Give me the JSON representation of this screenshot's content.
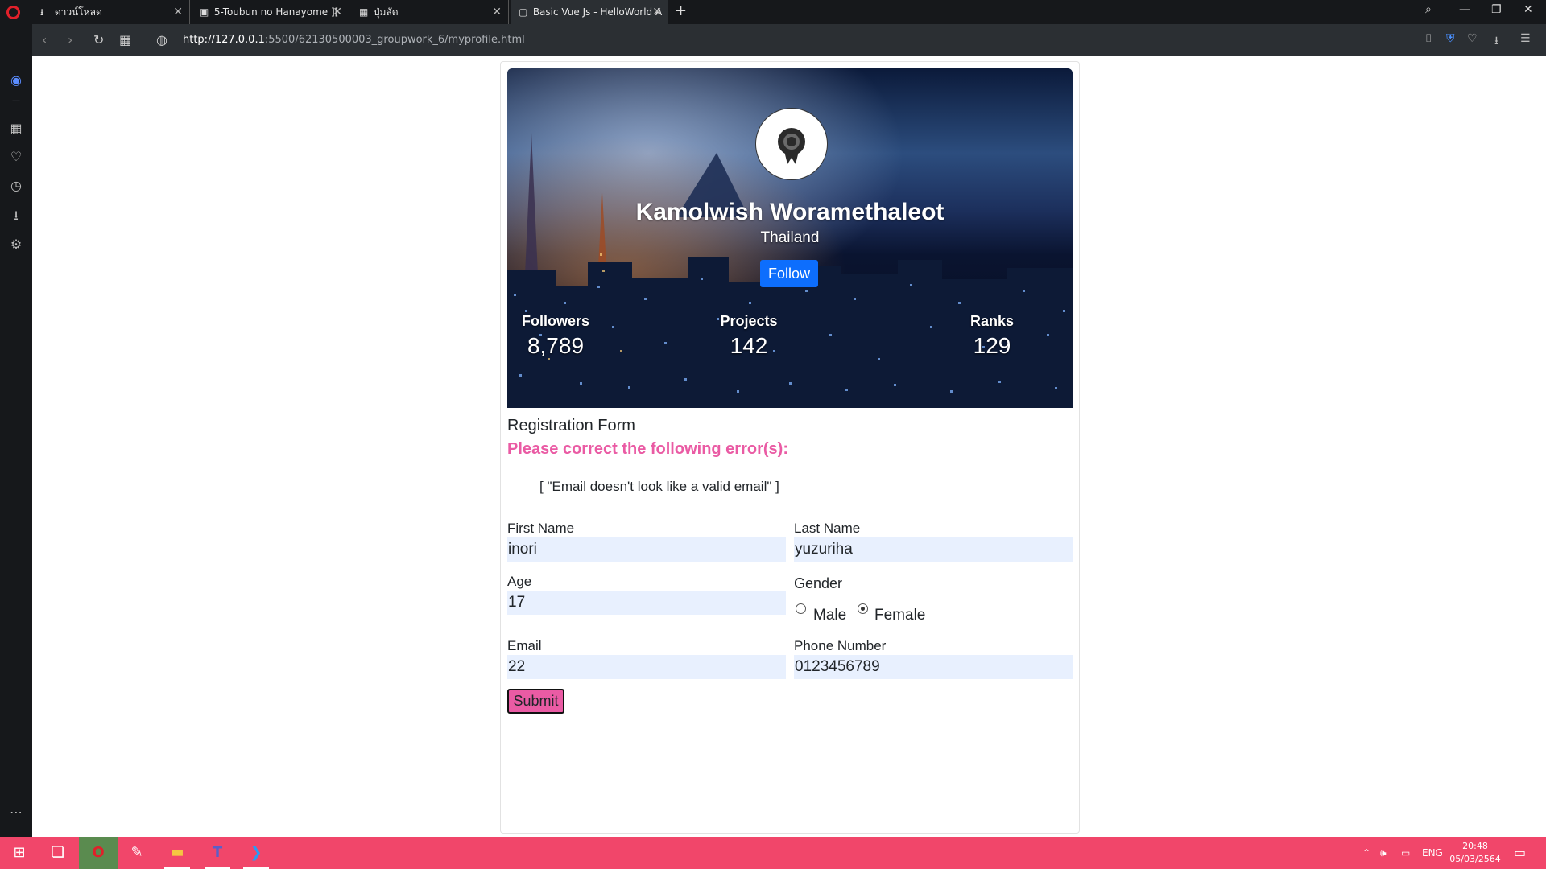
{
  "browser": {
    "tabs": [
      {
        "label": "ดาวน์โหลด",
        "icon": "download-icon"
      },
      {
        "label": "5-Toubun no Hanayome ][",
        "icon": "site-favicon"
      },
      {
        "label": "ปุ่มลัด",
        "icon": "grid-icon"
      },
      {
        "label": "Basic Vue Js - HelloWorld A",
        "icon": "page-icon"
      }
    ],
    "url_host": "http://127.0.0.1",
    "url_path": ":5500/62130500003_groupwork_6/myprofile.html",
    "new_tab": "+"
  },
  "profile": {
    "name": "Kamolwish Woramethaleot",
    "country": "Thailand",
    "follow_label": "Follow",
    "stats": [
      {
        "label": "Followers",
        "value": "8,789"
      },
      {
        "label": "Projects",
        "value": "142"
      },
      {
        "label": "Ranks",
        "value": "129"
      }
    ]
  },
  "form": {
    "title": "Registration Form",
    "error_heading": "Please correct the following error(s):",
    "errors_text": "[ \"Email doesn't look like a valid email\" ]",
    "first_name": {
      "label": "First Name",
      "value": "inori"
    },
    "last_name": {
      "label": "Last Name",
      "value": "yuzuriha"
    },
    "age": {
      "label": "Age",
      "value": "17"
    },
    "gender": {
      "label": "Gender",
      "options": [
        "Male",
        "Female"
      ],
      "selected": "Female"
    },
    "email": {
      "label": "Email",
      "value": "22"
    },
    "phone": {
      "label": "Phone Number",
      "value": "0123456789"
    },
    "submit_label": "Submit"
  },
  "taskbar": {
    "lang": "ENG",
    "time": "20:48",
    "date": "05/03/2564"
  },
  "colors": {
    "accent_pink": "#ea5ba4",
    "follow_blue": "#0d6efd",
    "taskbar": "#f1466a",
    "input_bg": "#e8f0fe"
  }
}
